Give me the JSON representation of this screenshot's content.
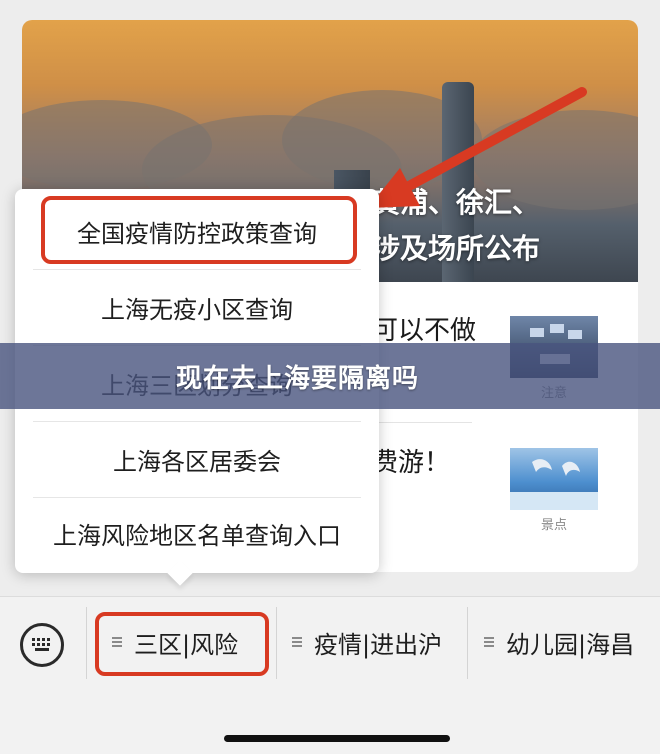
{
  "banner": {
    "headline_line1": "黄浦、徐汇、",
    "headline_line2": "涉及场所公布"
  },
  "articles": [
    {
      "text": "可以不做",
      "caption": "注意",
      "thumb_icon": "office-photo"
    },
    {
      "text": "费游！",
      "caption": "景点",
      "thumb_icon": "dolphin-show-photo"
    }
  ],
  "popup_menu": {
    "items": [
      {
        "label": "全国疫情防控政策查询",
        "highlighted": true
      },
      {
        "label": "上海无疫小区查询"
      },
      {
        "label": "上海三区划分查询"
      },
      {
        "label": "上海各区居委会"
      },
      {
        "label": "上海风险地区名单查询入口"
      }
    ]
  },
  "overlay": {
    "title": "现在去上海要隔离吗"
  },
  "bottom_bar": {
    "keyboard_icon": "keyboard-icon",
    "tabs": [
      {
        "label": "三区|风险",
        "highlighted": true
      },
      {
        "label": "疫情|进出沪"
      },
      {
        "label": "幼儿园|海昌"
      }
    ]
  },
  "colors": {
    "highlight": "#d83a22",
    "arrow": "#d83a22",
    "overlay": "#48547e"
  }
}
